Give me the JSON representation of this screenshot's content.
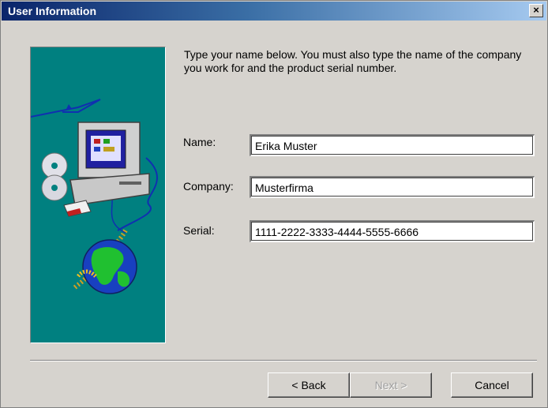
{
  "window": {
    "title": "User Information",
    "close_glyph": "×"
  },
  "intro_text": "Type your name below. You must also type the name of the company you work for and the product serial number.",
  "fields": {
    "name": {
      "label": "Name:",
      "value": "Erika Muster"
    },
    "company": {
      "label": "Company:",
      "value": "Musterfirma"
    },
    "serial": {
      "label": "Serial:",
      "value": "1111-2222-3333-4444-5555-6666"
    }
  },
  "buttons": {
    "back": "< Back",
    "next": "Next >",
    "cancel": "Cancel"
  },
  "icons": {
    "illustration": "computer-globe-illustration"
  },
  "colors": {
    "title_bar": "#0a246a",
    "illustration_bg": "#008080",
    "dialog_bg": "#d6d3ce"
  }
}
